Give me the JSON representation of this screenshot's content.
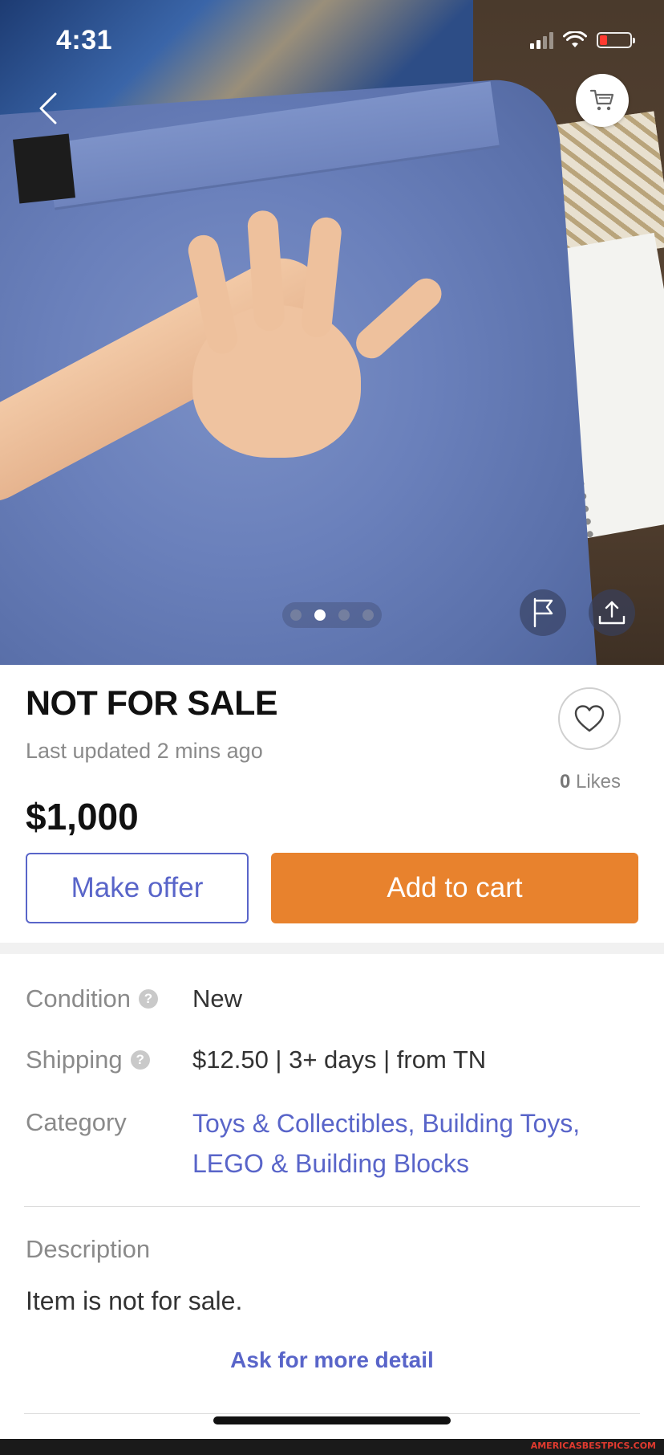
{
  "status_bar": {
    "time": "4:31"
  },
  "photo": {
    "page_count": 4,
    "active_index": 1
  },
  "product": {
    "title": "NOT FOR SALE",
    "updated": "Last updated 2 mins ago",
    "price": "$1,000",
    "likes_count": "0",
    "likes_label": "Likes"
  },
  "actions": {
    "make_offer": "Make offer",
    "add_to_cart": "Add to cart"
  },
  "details": {
    "condition_label": "Condition",
    "condition_value": "New",
    "shipping_label": "Shipping",
    "shipping_value": "$12.50 | 3+ days | from TN",
    "category_label": "Category",
    "category_links": [
      "Toys & Collectibles,",
      "Building Toys,",
      "LEGO & Building Blocks"
    ],
    "help_glyph": "?"
  },
  "description": {
    "label": "Description",
    "text": "Item is not for sale.",
    "ask_link": "Ask for more detail"
  },
  "watermark": "AMERICASBESTPICS.COM",
  "colors": {
    "accent": "#5965c9",
    "cta": "#e8822d",
    "battery_low": "#ff3b30"
  },
  "icons": [
    "back-chevron-icon",
    "cart-icon",
    "flag-icon",
    "share-icon",
    "heart-icon",
    "help-icon",
    "wifi-icon",
    "signal-icon",
    "battery-icon"
  ]
}
